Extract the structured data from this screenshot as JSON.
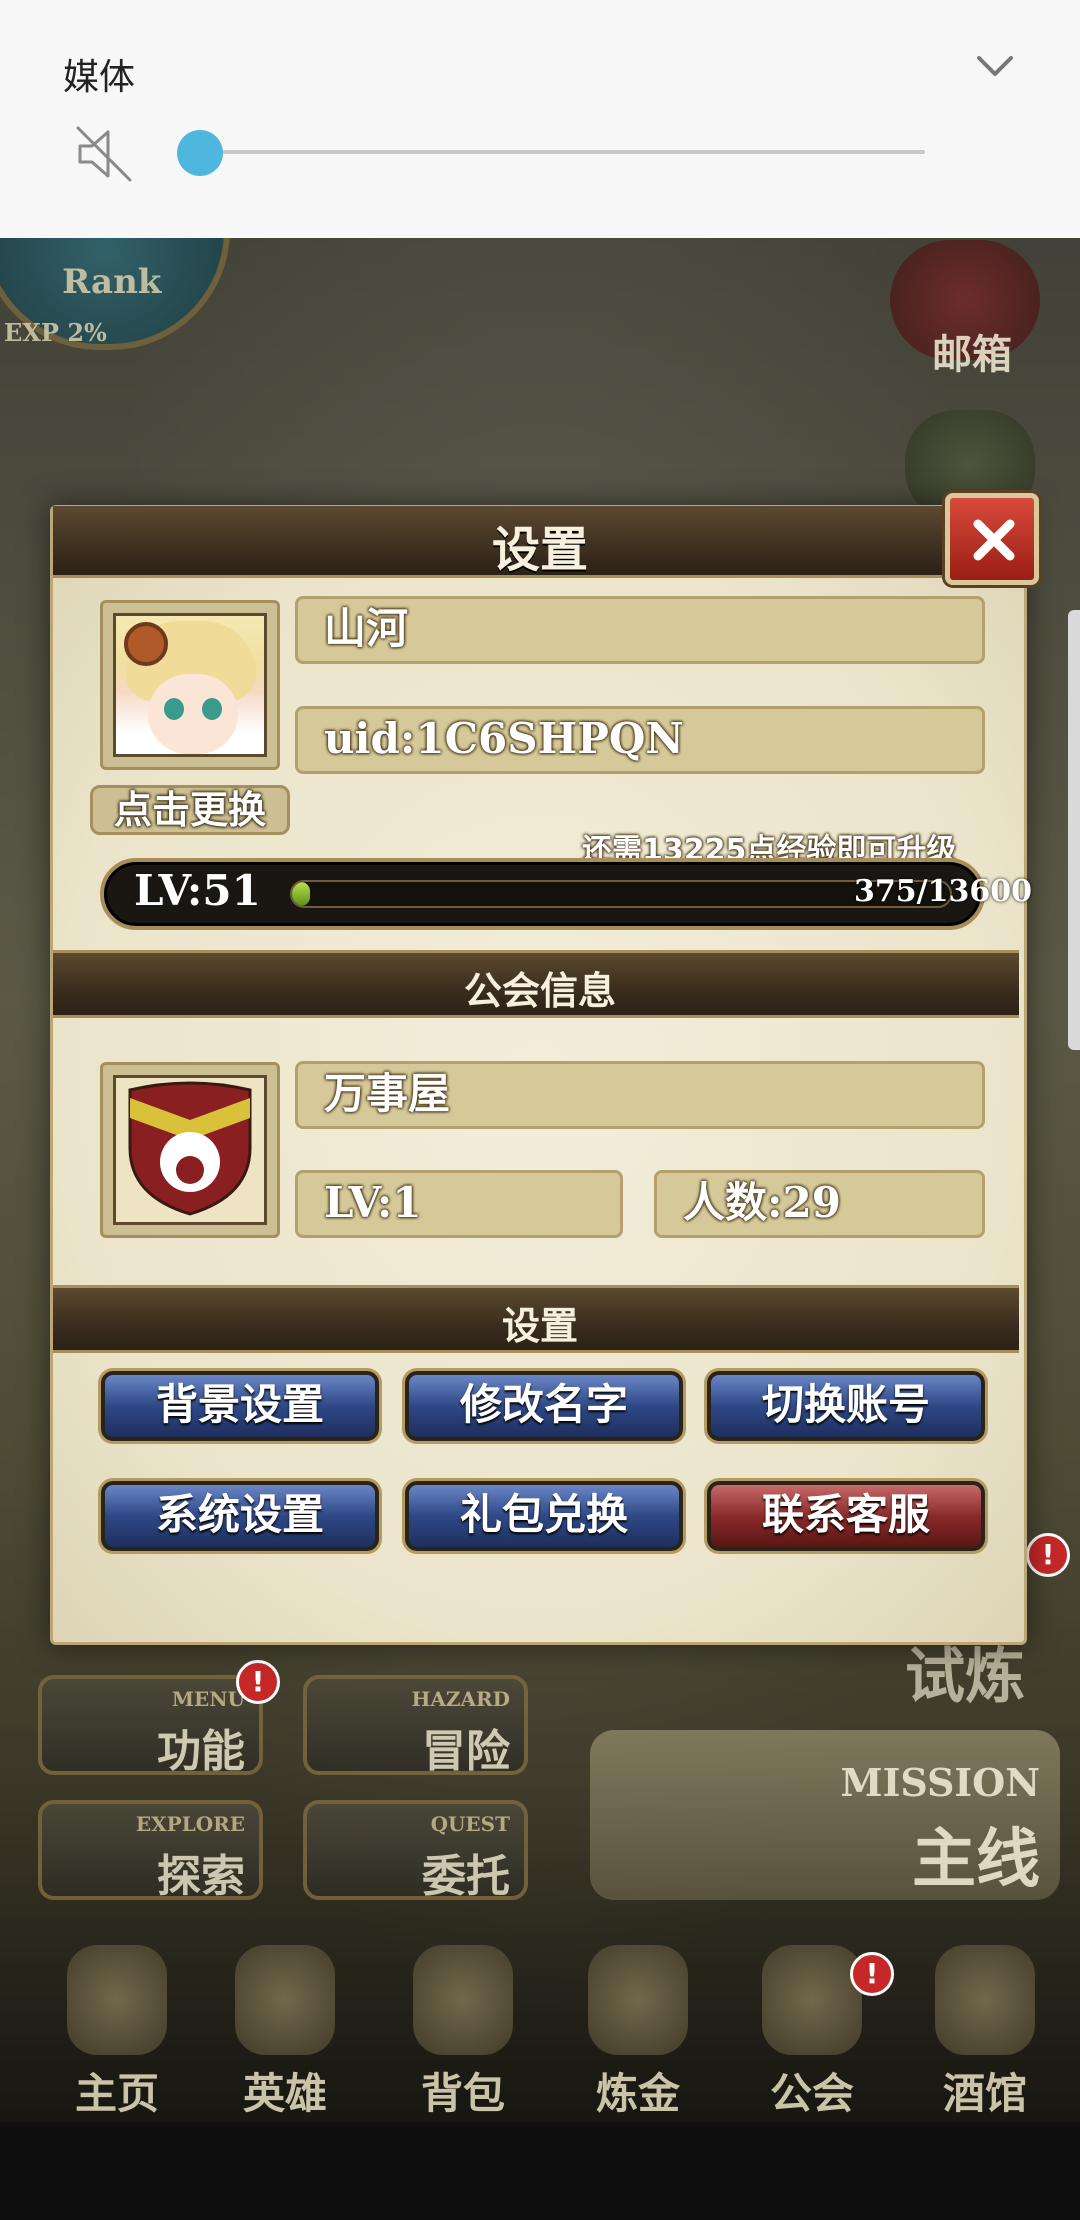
{
  "system": {
    "media_title": "媒体",
    "volume_percent": 3,
    "accent_color": "#4fb6de"
  },
  "game_background": {
    "rank_label": "Rank",
    "exp_label": "EXP 2%",
    "mail_label": "邮箱",
    "trial_label": "试炼",
    "menu_buttons": [
      {
        "en": "MENU",
        "cn": "功能"
      },
      {
        "en": "HAZARD",
        "cn": "冒险"
      },
      {
        "en": "EXPLORE",
        "cn": "探索"
      },
      {
        "en": "QUEST",
        "cn": "委托"
      }
    ],
    "mission": {
      "en": "MISSION",
      "cn": "主线"
    },
    "nav": [
      "主页",
      "英雄",
      "背包",
      "炼金",
      "公会",
      "酒馆"
    ],
    "alert_badge": "!"
  },
  "dialog": {
    "title": "设置",
    "player": {
      "name": "山河",
      "uid": "uid:1C6SHPQN",
      "change_avatar_label": "点击更换",
      "exp_hint": "还需13225点经验即可升级",
      "level_label": "LV:51",
      "exp_current": 375,
      "exp_max": 13600,
      "exp_text": "375/13600"
    },
    "guild_section_title": "公会信息",
    "guild": {
      "name": "万事屋",
      "level": "LV:1",
      "members": "人数:29"
    },
    "settings_section_title": "设置",
    "buttons": {
      "background": "背景设置",
      "rename": "修改名字",
      "switch_account": "切换账号",
      "system": "系统设置",
      "gift_code": "礼包兑换",
      "support": "联系客服"
    }
  }
}
